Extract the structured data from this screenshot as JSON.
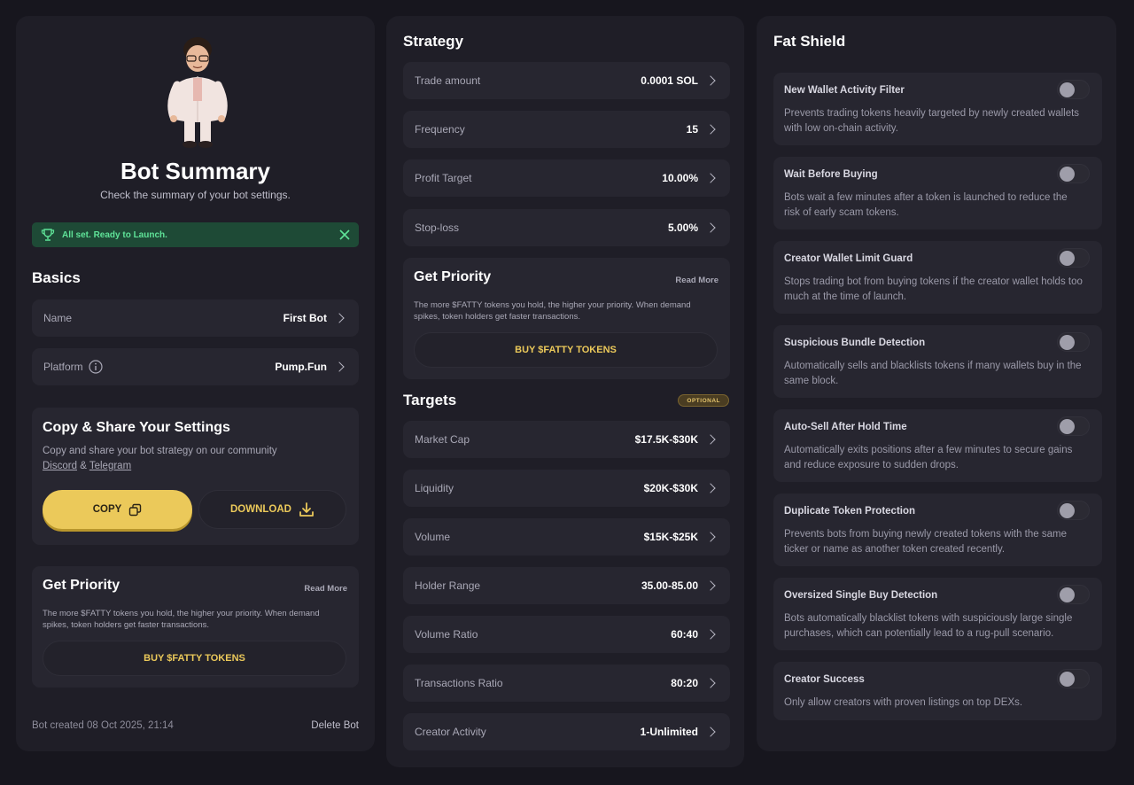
{
  "left": {
    "title": "Bot Summary",
    "subtitle": "Check the summary of your bot settings.",
    "status": "All set. Ready to Launch.",
    "basics_heading": "Basics",
    "basics": [
      {
        "label": "Name",
        "value": "First Bot"
      },
      {
        "label": "Platform",
        "value": "Pump.Fun"
      }
    ],
    "copy": {
      "title": "Copy & Share Your Settings",
      "desc": "Copy and share your bot strategy on our community",
      "link1": "Discord",
      "amp": "&",
      "link2": "Telegram",
      "copy_label": "COPY",
      "download_label": "DOWNLOAD"
    },
    "priority": {
      "title": "Get Priority",
      "read_more": "Read More",
      "desc": "The more $FATTY tokens you hold, the higher your priority. When demand spikes, token holders get faster transactions.",
      "button": "BUY $FATTY TOKENS"
    },
    "created": "Bot created 08 Oct 2025, 21:14",
    "delete": "Delete Bot"
  },
  "mid": {
    "strategy_heading": "Strategy",
    "strategy": [
      {
        "label": "Trade amount",
        "value": "0.0001 SOL"
      },
      {
        "label": "Frequency",
        "value": "15"
      },
      {
        "label": "Profit Target",
        "value": "10.00%"
      },
      {
        "label": "Stop-loss",
        "value": "5.00%"
      }
    ],
    "priority": {
      "title": "Get Priority",
      "read_more": "Read More",
      "desc": "The more $FATTY tokens you hold, the higher your priority. When demand spikes, token holders get faster transactions.",
      "button": "BUY $FATTY TOKENS"
    },
    "targets_heading": "Targets",
    "targets_badge": "OPTIONAL",
    "targets": [
      {
        "label": "Market Cap",
        "value": "$17.5K-$30K"
      },
      {
        "label": "Liquidity",
        "value": "$20K-$30K"
      },
      {
        "label": "Volume",
        "value": "$15K-$25K"
      },
      {
        "label": "Holder Range",
        "value": "35.00-85.00"
      },
      {
        "label": "Volume Ratio",
        "value": "60:40"
      },
      {
        "label": "Transactions Ratio",
        "value": "80:20"
      },
      {
        "label": "Creator Activity",
        "value": "1-Unlimited"
      }
    ]
  },
  "right": {
    "heading": "Fat Shield",
    "items": [
      {
        "title": "New Wallet Activity Filter",
        "desc": "Prevents trading tokens heavily targeted by newly created wallets with low on-chain activity.",
        "enabled": false
      },
      {
        "title": "Wait Before Buying",
        "desc": "Bots wait a few minutes after a token is launched to reduce the risk of early scam tokens.",
        "enabled": false
      },
      {
        "title": "Creator Wallet Limit Guard",
        "desc": "Stops trading bot from buying tokens if the creator wallet holds too much at the time of launch.",
        "enabled": false
      },
      {
        "title": "Suspicious Bundle Detection",
        "desc": "Automatically sells and blacklists tokens if many wallets buy in the same block.",
        "enabled": false
      },
      {
        "title": "Auto-Sell After Hold Time",
        "desc": "Automatically exits positions after a few minutes to secure gains and reduce exposure to sudden drops.",
        "enabled": false
      },
      {
        "title": "Duplicate Token Protection",
        "desc": "Prevents bots from buying newly created tokens with the same ticker or name as another token created recently.",
        "enabled": false
      },
      {
        "title": "Oversized Single Buy Detection",
        "desc": "Bots automatically blacklist tokens with suspiciously large single purchases, which can potentially lead to a rug-pull scenario.",
        "enabled": false
      },
      {
        "title": "Creator Success",
        "desc": "Only allow creators with proven listings on top DEXs.",
        "enabled": false
      }
    ]
  },
  "colors": {
    "accent": "#ebc95a",
    "success": "#5fe398",
    "panel": "#1f1e27",
    "card": "#272630"
  }
}
